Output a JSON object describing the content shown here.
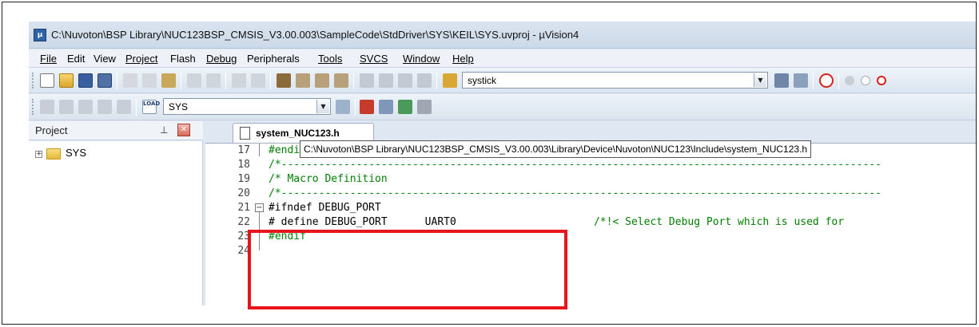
{
  "window": {
    "title": "C:\\Nuvoton\\BSP Library\\NUC123BSP_CMSIS_V3.00.003\\SampleCode\\StdDriver\\SYS\\KEIL\\SYS.uvproj - µVision4"
  },
  "menu": [
    {
      "label": "File",
      "name": "menu-file"
    },
    {
      "label": "Edit",
      "name": "menu-edit"
    },
    {
      "label": "View",
      "name": "menu-view"
    },
    {
      "label": "Project",
      "name": "menu-project"
    },
    {
      "label": "Flash",
      "name": "menu-flash"
    },
    {
      "label": "Debug",
      "name": "menu-debug"
    },
    {
      "label": "Peripherals",
      "name": "menu-peripherals"
    },
    {
      "label": "Tools",
      "name": "menu-tools"
    },
    {
      "label": "SVCS",
      "name": "menu-svcs"
    },
    {
      "label": "Window",
      "name": "menu-window"
    },
    {
      "label": "Help",
      "name": "menu-help"
    }
  ],
  "toolbar": {
    "find_value": "systick",
    "target_value": "SYS",
    "load_label": "LOAD"
  },
  "project_panel": {
    "title": "Project",
    "root": "SYS"
  },
  "editor": {
    "tab": "system_NUC123.h",
    "tooltip": "C:\\Nuvoton\\BSP Library\\NUC123BSP_CMSIS_V3.00.003\\Library\\Device\\Nuvoton\\NUC123\\Include\\system_NUC123.h",
    "lines": [
      {
        "n": "17",
        "text": "#endif"
      },
      {
        "n": "18",
        "text": "/*------------------------------------------------------------------------------------------------"
      },
      {
        "n": "19",
        "text": "/* Macro Definition"
      },
      {
        "n": "20",
        "text": "/*------------------------------------------------------------------------------------------------"
      },
      {
        "n": "21",
        "text": "#ifndef DEBUG_PORT"
      },
      {
        "n": "22",
        "text": "# define DEBUG_PORT      UART0",
        "comment": "/*!< Select Debug Port which is used for"
      },
      {
        "n": "23",
        "text": "#endif"
      },
      {
        "n": "24",
        "text": ""
      }
    ]
  },
  "colors": {
    "highlight": "#e8141c",
    "comment": "#008000"
  }
}
